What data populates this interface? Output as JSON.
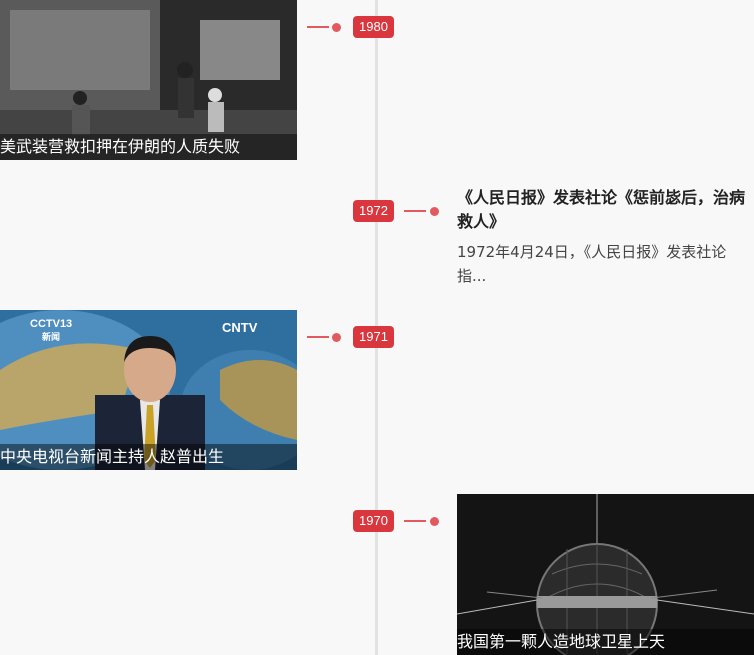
{
  "timeline": {
    "accent_color": "#d9363e",
    "events": [
      {
        "year": "1980",
        "caption": "美武装营救扣押在伊朗的人质失败",
        "image": "hostage-rescue-photo"
      },
      {
        "year": "1972",
        "title": "《人民日报》发表社论《惩前毖后，治病救人》",
        "summary": "1972年4月24日，《人民日报》发表社论指..."
      },
      {
        "year": "1971",
        "caption": "中央电视台新闻主持人赵普出生",
        "image": "news-anchor-photo",
        "logo_left": "CCTV13",
        "logo_left_sub": "新闻",
        "logo_right": "CNTV"
      },
      {
        "year": "1970",
        "caption": "我国第一颗人造地球卫星上天",
        "image": "satellite-photo"
      }
    ]
  }
}
